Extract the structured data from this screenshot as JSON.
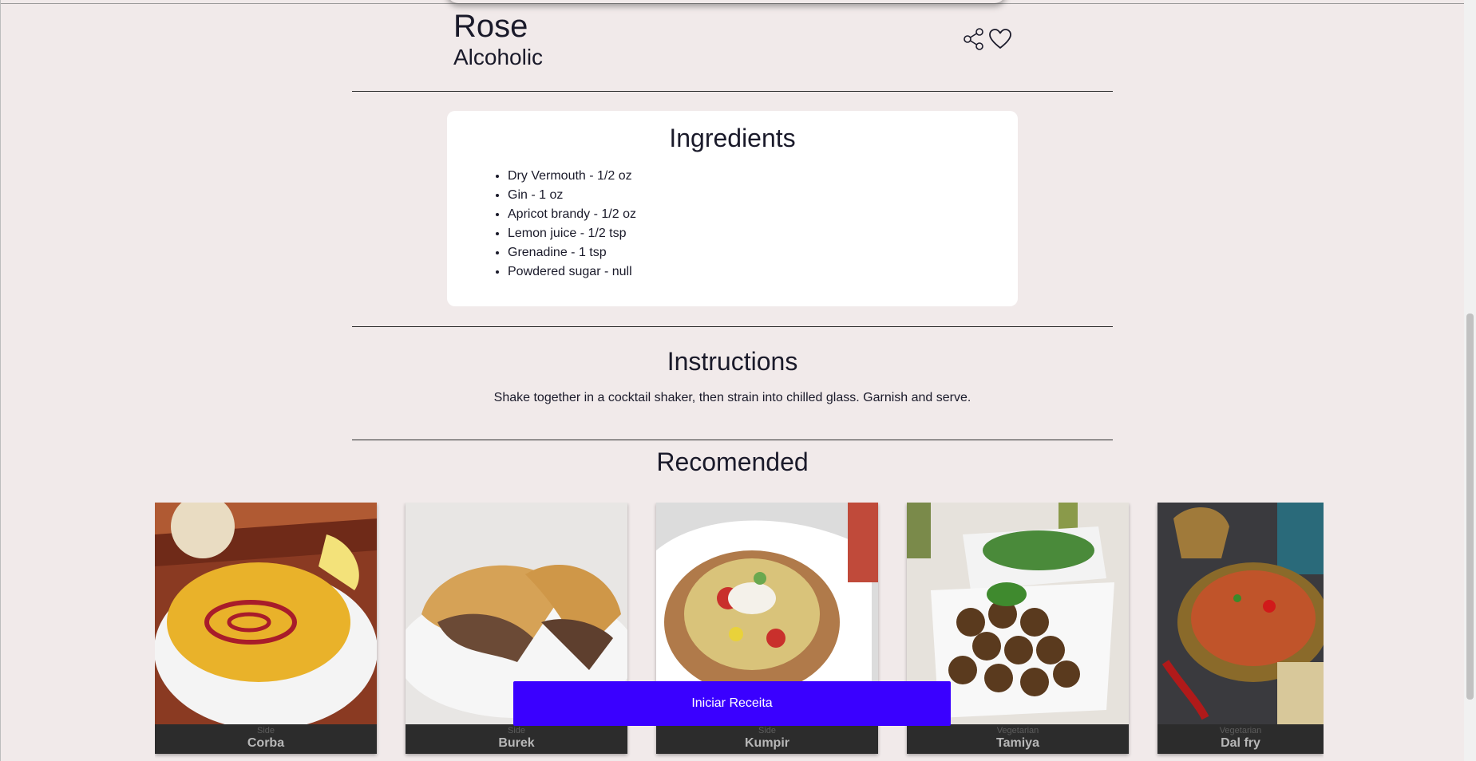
{
  "recipe": {
    "title": "Rose",
    "category": "Alcoholic",
    "share_icon": "share-icon",
    "favorite_icon": "heart-outline-icon"
  },
  "ingredients": {
    "heading": "Ingredients",
    "items": [
      "Dry Vermouth - 1/2 oz",
      "Gin - 1 oz",
      "Apricot brandy - 1/2 oz",
      "Lemon juice - 1/2 tsp",
      "Grenadine - 1 tsp",
      "Powdered sugar - null"
    ]
  },
  "instructions": {
    "heading": "Instructions",
    "text": "Shake together in a cocktail shaker, then strain into chilled glass. Garnish and serve."
  },
  "recommended": {
    "heading": "Recomended",
    "cards": [
      {
        "category": "Side",
        "name": "Corba"
      },
      {
        "category": "Side",
        "name": "Burek"
      },
      {
        "category": "Side",
        "name": "Kumpir"
      },
      {
        "category": "Vegetarian",
        "name": "Tamiya"
      },
      {
        "category": "Vegetarian",
        "name": "Dal fry"
      }
    ]
  },
  "start_button": {
    "label": "Iniciar Receita"
  },
  "colors": {
    "background": "#f1eaea",
    "accent": "#3a00ff",
    "card_caption": "#2c2c2c"
  }
}
